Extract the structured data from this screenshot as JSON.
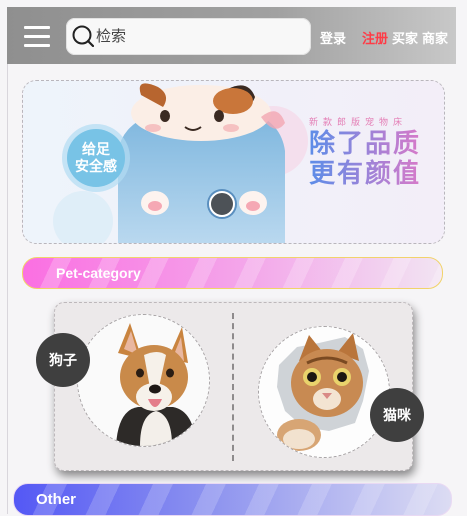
{
  "header": {
    "search_placeholder": "检索",
    "login": "登录",
    "register": "注册",
    "buyer": "买家",
    "merchant": "商家",
    "colors": {
      "register": "#ff3b46",
      "link": "#ffffff"
    }
  },
  "banner": {
    "badge_line1": "给足",
    "badge_line2": "安全感",
    "small_text": "新款郎版宠物床",
    "headline1": "除了品质",
    "headline2": "更有颜值"
  },
  "pet_section": {
    "title": "Pet-category",
    "dog_label": "狗子",
    "cat_label": "猫咪"
  },
  "other_section": {
    "title": "Other"
  }
}
